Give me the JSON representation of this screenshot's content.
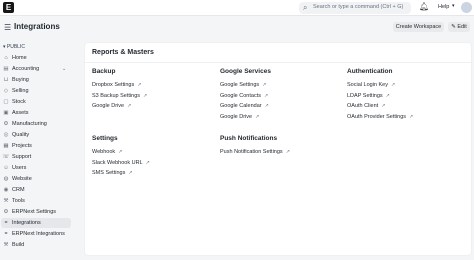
{
  "topbar": {
    "logo": "E",
    "search_placeholder": "Search or type a command (Ctrl + G)",
    "help_label": "Help"
  },
  "header": {
    "title": "Integrations",
    "create_workspace": "Create Workspace",
    "edit": "Edit"
  },
  "sidebar": {
    "section": "PUBLIC",
    "items": [
      {
        "label": "Home",
        "icon": "home-icon"
      },
      {
        "label": "Accounting",
        "icon": "accounting-icon"
      },
      {
        "label": "Buying",
        "icon": "cart-icon"
      },
      {
        "label": "Selling",
        "icon": "tag-icon"
      },
      {
        "label": "Stock",
        "icon": "box-icon"
      },
      {
        "label": "Assets",
        "icon": "assets-icon"
      },
      {
        "label": "Manufacturing",
        "icon": "factory-icon"
      },
      {
        "label": "Quality",
        "icon": "quality-icon"
      },
      {
        "label": "Projects",
        "icon": "projects-icon"
      },
      {
        "label": "Support",
        "icon": "support-icon"
      },
      {
        "label": "Users",
        "icon": "users-icon"
      },
      {
        "label": "Website",
        "icon": "web-icon"
      },
      {
        "label": "CRM",
        "icon": "crm-icon"
      },
      {
        "label": "Tools",
        "icon": "tools-icon"
      },
      {
        "label": "ERPNext Settings",
        "icon": "settings-icon"
      },
      {
        "label": "Integrations",
        "icon": "integrations-icon"
      },
      {
        "label": "ERPNext Integrations",
        "icon": "link-icon"
      },
      {
        "label": "Build",
        "icon": "build-icon"
      }
    ]
  },
  "main": {
    "card_title": "Reports & Masters",
    "columns": [
      {
        "title": "Backup",
        "links": [
          "Dropbox Settings",
          "S3 Backup Settings",
          "Google Drive"
        ]
      },
      {
        "title": "Google Services",
        "links": [
          "Google Settings",
          "Google Contacts",
          "Google Calendar",
          "Google Drive"
        ]
      },
      {
        "title": "Authentication",
        "links": [
          "Social Login Key",
          "LDAP Settings",
          "OAuth Client",
          "OAuth Provider Settings"
        ]
      },
      {
        "title": "Settings",
        "links": [
          "Webhook",
          "Slack Webhook URL",
          "SMS Settings"
        ]
      },
      {
        "title": "Push Notifications",
        "links": [
          "Push Notification Settings"
        ]
      }
    ]
  }
}
